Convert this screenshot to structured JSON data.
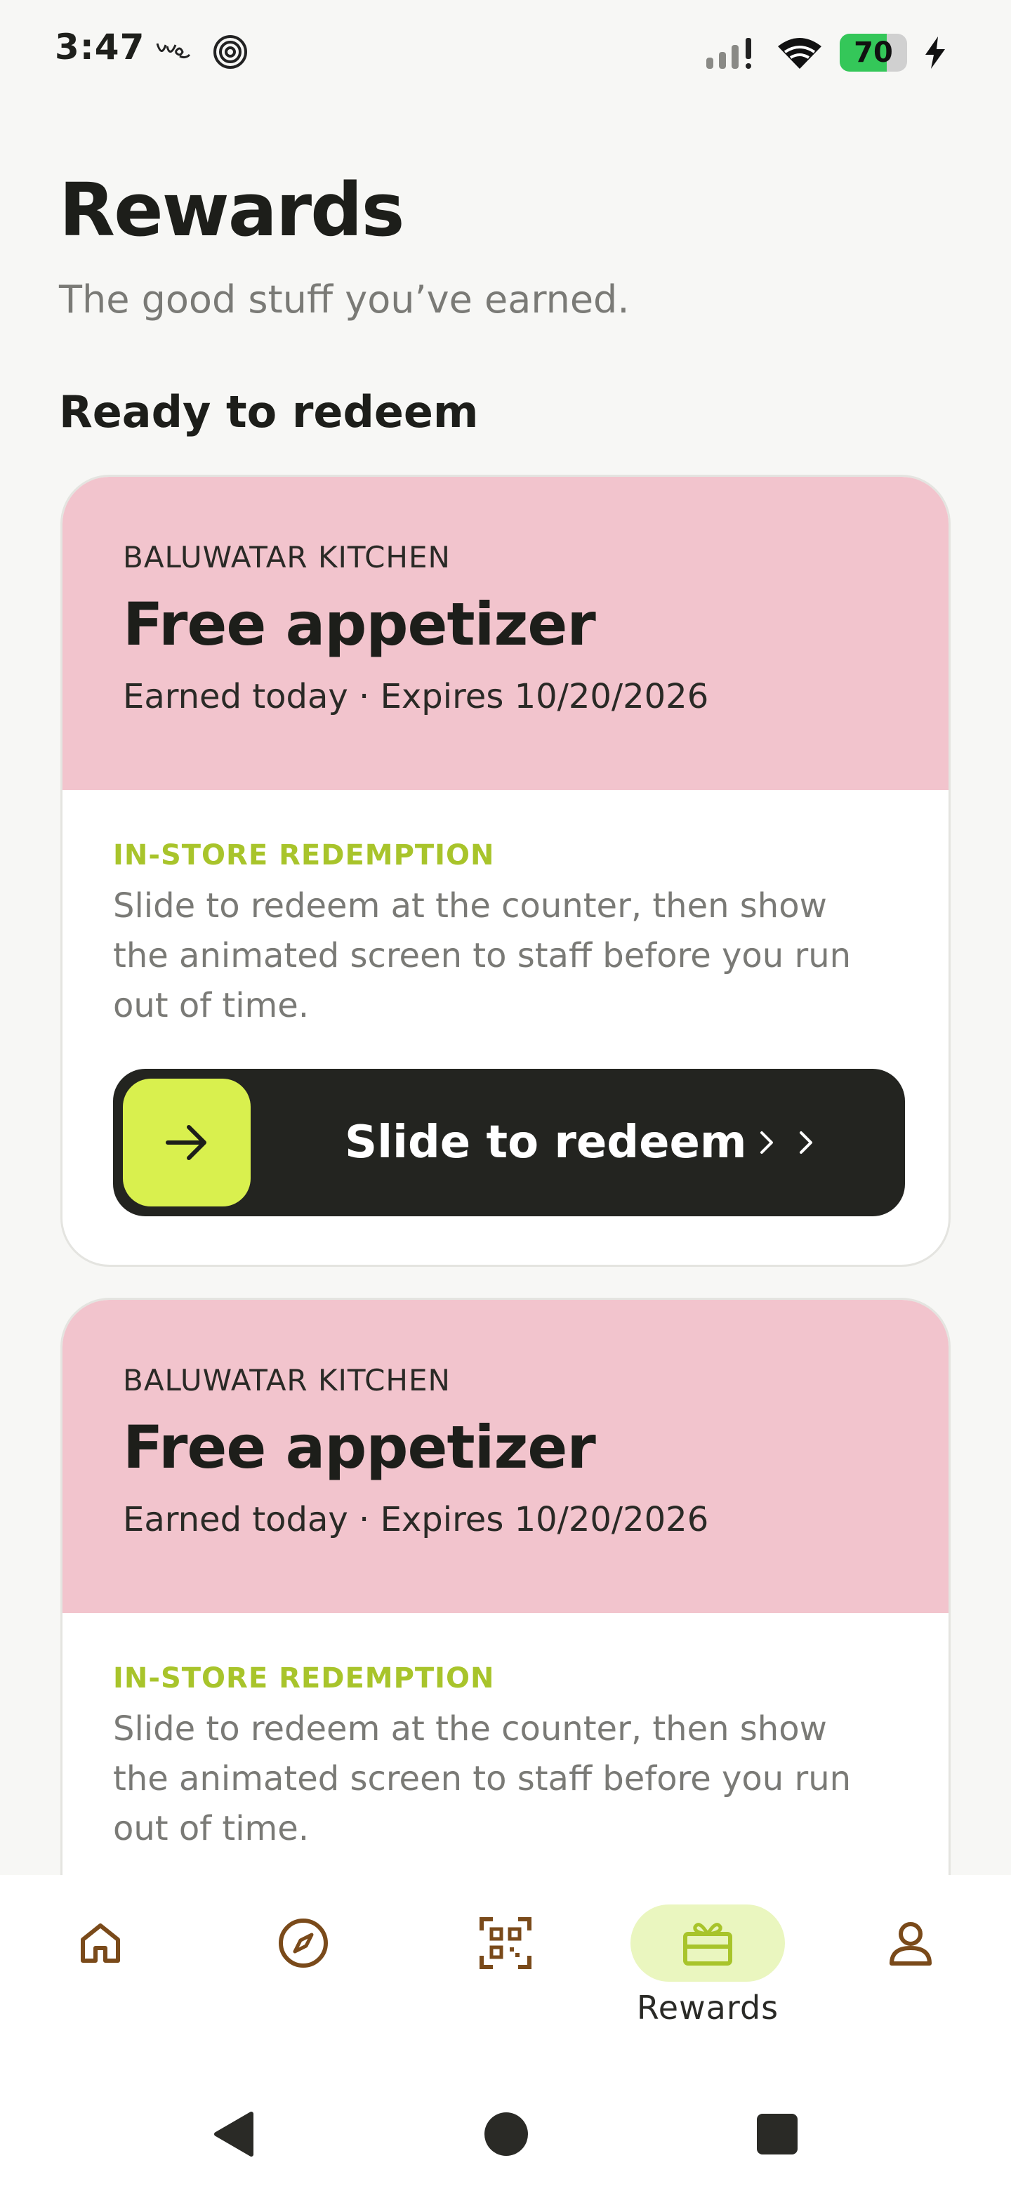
{
  "status_bar": {
    "time": "3:47",
    "battery": "70",
    "icons": [
      "vybe-app-icon",
      "target-app-icon",
      "signal-icon",
      "wifi-icon",
      "battery-icon",
      "charging-icon"
    ]
  },
  "header": {
    "title": "Rewards",
    "subtitle": "The good stuff you’ve earned."
  },
  "section": {
    "title": "Ready to redeem"
  },
  "rewards": [
    {
      "merchant": "BALUWATAR KITCHEN",
      "title": "Free appetizer",
      "meta": "Earned today · Expires 10/20/2026",
      "label": "IN-STORE REDEMPTION",
      "description": "Slide to redeem at the counter, then show the animated screen to staff before you run out of time.",
      "slider_label": "Slide to redeem"
    },
    {
      "merchant": "BALUWATAR KITCHEN",
      "title": "Free appetizer",
      "meta": "Earned today · Expires 10/20/2026",
      "label": "IN-STORE REDEMPTION",
      "description": "Slide to redeem at the counter, then show the animated screen to staff before you run out of time."
    }
  ],
  "nav": {
    "items": [
      {
        "icon": "home-icon",
        "label": ""
      },
      {
        "icon": "compass-icon",
        "label": ""
      },
      {
        "icon": "qr-scan-icon",
        "label": ""
      },
      {
        "icon": "gift-icon",
        "label": "Rewards",
        "active": true
      },
      {
        "icon": "profile-icon",
        "label": ""
      }
    ]
  },
  "colors": {
    "card_top": "#f2c4cd",
    "accent": "#d9f04e",
    "accent_text": "#a8c42b",
    "slider_bg": "#232420",
    "nav_icon": "#7a4a1a",
    "active_pill": "#eaf6bf"
  }
}
